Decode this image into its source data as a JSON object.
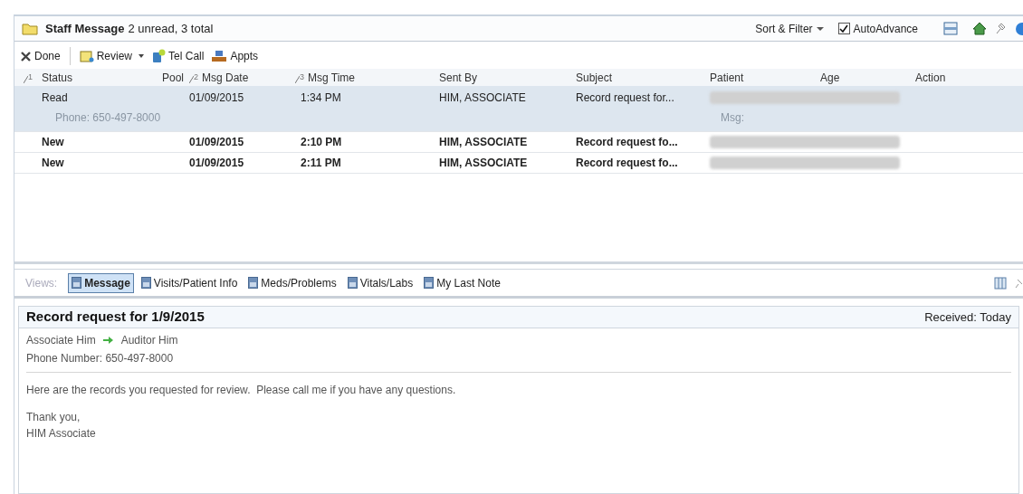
{
  "header": {
    "title": "Staff Message",
    "summary": "2 unread, 3 total",
    "sort_filter": "Sort & Filter",
    "auto_advance": {
      "label": "AutoAdvance",
      "checked": true
    }
  },
  "toolbar": [
    {
      "kind": "done",
      "label": "Done"
    },
    {
      "kind": "review",
      "label": "Review",
      "dropdown": true
    },
    {
      "kind": "phone",
      "label": "Tel Call"
    },
    {
      "kind": "appts",
      "label": "Appts"
    }
  ],
  "table": {
    "columns": [
      {
        "label": "Status",
        "sort_rank": "1"
      },
      {
        "label": "Pool"
      },
      {
        "label": "Msg Date",
        "sort_rank": "2"
      },
      {
        "label": "Msg Time",
        "sort_rank": "3"
      },
      {
        "label": "Sent By"
      },
      {
        "label": "Subject"
      },
      {
        "label": "Patient"
      },
      {
        "label": "Age"
      },
      {
        "label": "Action"
      }
    ],
    "rows": [
      {
        "status": "Read",
        "msg_date": "01/09/2015",
        "msg_time": "1:34 PM",
        "sent_by": "HIM, ASSOCIATE",
        "subject": "Record request for...",
        "unread": false,
        "selected": true,
        "phone": "Phone: 650-497-8000",
        "msg_label": "Msg:"
      },
      {
        "status": "New",
        "msg_date": "01/09/2015",
        "msg_time": "2:10 PM",
        "sent_by": "HIM, ASSOCIATE",
        "subject": "Record request fo...",
        "unread": true,
        "selected": false
      },
      {
        "status": "New",
        "msg_date": "01/09/2015",
        "msg_time": "2:11 PM",
        "sent_by": "HIM, ASSOCIATE",
        "subject": "Record request fo...",
        "unread": true,
        "selected": false
      }
    ]
  },
  "views": {
    "label": "Views:",
    "tabs": [
      {
        "label": "Message",
        "selected": true
      },
      {
        "label": "Visits/Patient Info",
        "selected": false
      },
      {
        "label": "Meds/Problems",
        "selected": false
      },
      {
        "label": "Vitals/Labs",
        "selected": false
      },
      {
        "label": "My Last Note",
        "selected": false
      }
    ]
  },
  "message": {
    "title": "Record request for 1/9/2015",
    "received": "Received: Today",
    "from": "Associate Him",
    "to": "Auditor Him",
    "phone": "Phone Number: 650-497-8000",
    "body": "Here are the records you requested for review.  Please call me if you have any questions.",
    "closing": [
      "Thank you,",
      "HIM Associate"
    ]
  }
}
